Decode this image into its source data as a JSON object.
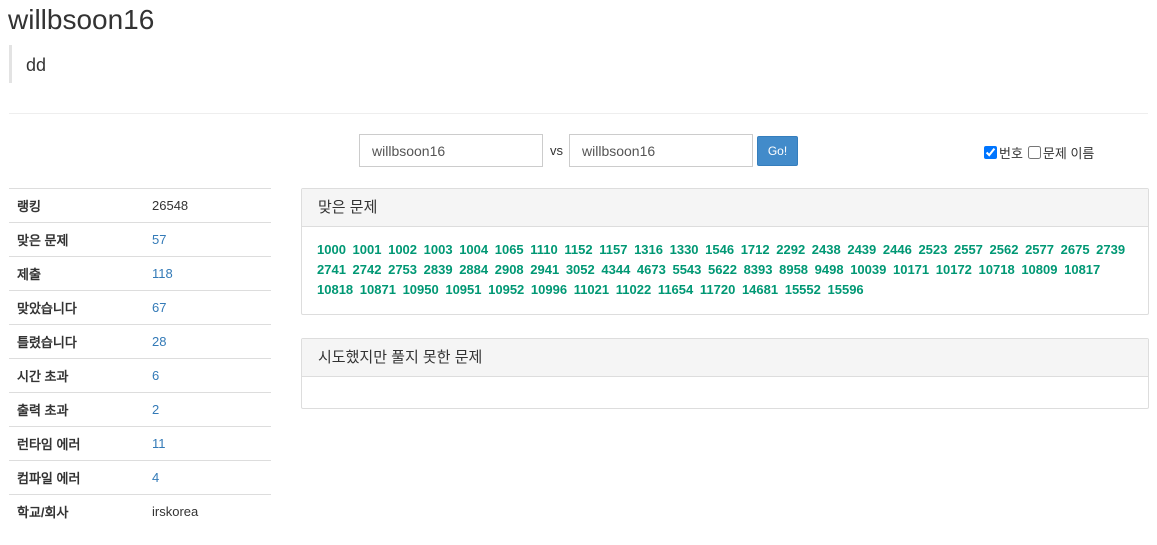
{
  "user": {
    "name": "willbsoon16",
    "status_message": "dd"
  },
  "compare": {
    "left_value": "willbsoon16",
    "vs_label": "vs",
    "right_value": "willbsoon16",
    "go_label": "Go!"
  },
  "options": {
    "number_label": "번호",
    "number_checked": true,
    "name_label": "문제 이름",
    "name_checked": false
  },
  "stats": [
    {
      "key": "랭킹",
      "value": "26548",
      "link": false
    },
    {
      "key": "맞은 문제",
      "value": "57",
      "link": true
    },
    {
      "key": "제출",
      "value": "118",
      "link": true
    },
    {
      "key": "맞았습니다",
      "value": "67",
      "link": true
    },
    {
      "key": "틀렸습니다",
      "value": "28",
      "link": true
    },
    {
      "key": "시간 초과",
      "value": "6",
      "link": true
    },
    {
      "key": "출력 초과",
      "value": "2",
      "link": true
    },
    {
      "key": "런타임 에러",
      "value": "11",
      "link": true
    },
    {
      "key": "컴파일 에러",
      "value": "4",
      "link": true
    },
    {
      "key": "학교/회사",
      "value": "irskorea",
      "link": false
    }
  ],
  "solved_panel": {
    "title": "맞은 문제",
    "problems": [
      "1000",
      "1001",
      "1002",
      "1003",
      "1004",
      "1065",
      "1110",
      "1152",
      "1157",
      "1316",
      "1330",
      "1546",
      "1712",
      "2292",
      "2438",
      "2439",
      "2446",
      "2523",
      "2557",
      "2562",
      "2577",
      "2675",
      "2739",
      "2741",
      "2742",
      "2753",
      "2839",
      "2884",
      "2908",
      "2941",
      "3052",
      "4344",
      "4673",
      "5543",
      "5622",
      "8393",
      "8958",
      "9498",
      "10039",
      "10171",
      "10172",
      "10718",
      "10809",
      "10817",
      "10818",
      "10871",
      "10950",
      "10951",
      "10952",
      "10996",
      "11021",
      "11022",
      "11654",
      "11720",
      "14681",
      "15552",
      "15596"
    ]
  },
  "failed_panel": {
    "title": "시도했지만 풀지 못한 문제",
    "problems": []
  },
  "colors": {
    "accent": "#428bca",
    "link": "#337ab7",
    "problem": "#009874"
  }
}
